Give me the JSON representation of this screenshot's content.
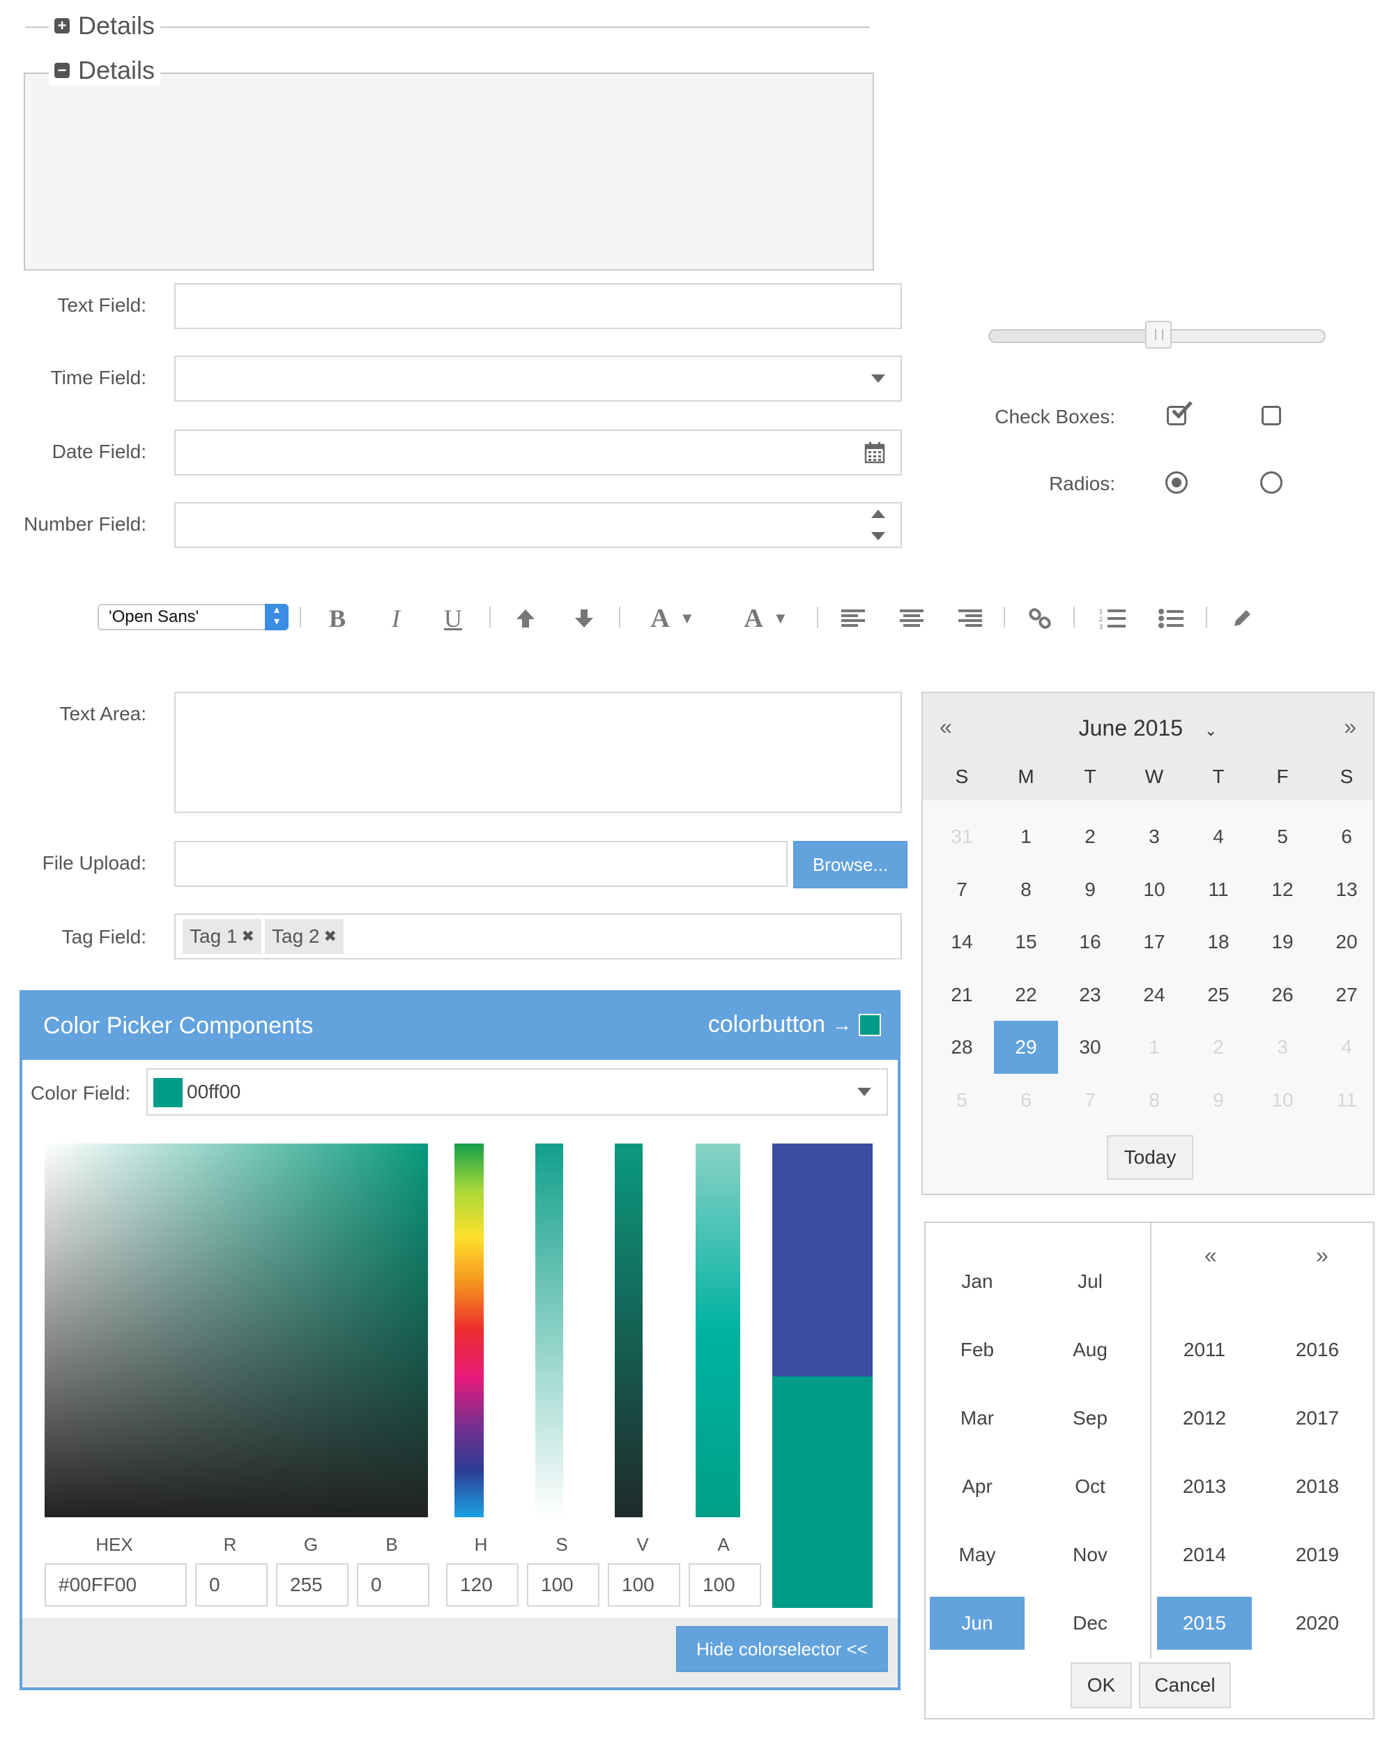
{
  "fieldsets": {
    "collapsed": {
      "legend": "Details",
      "icon": "plus-square-icon"
    },
    "expanded": {
      "legend": "Details",
      "icon": "minus-square-icon"
    }
  },
  "form": {
    "text_field": {
      "label": "Text Field:",
      "value": ""
    },
    "time_field": {
      "label": "Time Field:",
      "value": "",
      "icon": "caret-down-icon"
    },
    "date_field": {
      "label": "Date Field:",
      "value": "",
      "icon": "calendar-icon"
    },
    "number_field": {
      "label": "Number Field:",
      "value": "",
      "icon": "spinner-arrows-icon"
    },
    "text_area": {
      "label": "Text Area:",
      "value": ""
    },
    "file_upload": {
      "label": "File Upload:",
      "value": "",
      "button": "Browse..."
    },
    "tag_field": {
      "label": "Tag Field:",
      "tags": [
        "Tag 1",
        "Tag 2"
      ]
    }
  },
  "slider": {
    "value": 0.5
  },
  "checkboxes": {
    "label": "Check Boxes:",
    "states": [
      true,
      false
    ]
  },
  "radios": {
    "label": "Radios:",
    "states": [
      true,
      false
    ]
  },
  "toolbar": {
    "font": "'Open Sans'",
    "buttons": [
      "bold",
      "italic",
      "underline",
      "superscript",
      "subscript",
      "font-color",
      "highlight-color",
      "align-left",
      "align-center",
      "align-right",
      "link",
      "ordered-list",
      "unordered-list",
      "source"
    ]
  },
  "color_picker": {
    "title": "Color Picker Components",
    "colorbutton_label": "colorbutton",
    "colorbutton_color": "#009c87",
    "color_field_label": "Color Field:",
    "color_field_value": "00ff00",
    "color_field_swatch": "#009c87",
    "channels": {
      "HEX": "#00FF00",
      "R": "0",
      "G": "255",
      "B": "0",
      "H": "120",
      "S": "100",
      "V": "100",
      "A": "100"
    },
    "preview_old": "#3a4d9e",
    "preview_new": "#009c87",
    "hide_button": "Hide colorselector <<"
  },
  "calendar": {
    "title": "June 2015",
    "weekdays": [
      "S",
      "M",
      "T",
      "W",
      "T",
      "F",
      "S"
    ],
    "weeks": [
      [
        "31",
        "1",
        "2",
        "3",
        "4",
        "5",
        "6"
      ],
      [
        "7",
        "8",
        "9",
        "10",
        "11",
        "12",
        "13"
      ],
      [
        "14",
        "15",
        "16",
        "17",
        "18",
        "19",
        "20"
      ],
      [
        "21",
        "22",
        "23",
        "24",
        "25",
        "26",
        "27"
      ],
      [
        "28",
        "29",
        "30",
        "1",
        "2",
        "3",
        "4"
      ],
      [
        "5",
        "6",
        "7",
        "8",
        "9",
        "10",
        "11"
      ]
    ],
    "selected": "29",
    "today_button": "Today"
  },
  "month_year_picker": {
    "months_left": [
      "Jan",
      "Feb",
      "Mar",
      "Apr",
      "May",
      "Jun"
    ],
    "months_right": [
      "Jul",
      "Aug",
      "Sep",
      "Oct",
      "Nov",
      "Dec"
    ],
    "years_left": [
      "2011",
      "2012",
      "2013",
      "2014",
      "2015"
    ],
    "years_right": [
      "2016",
      "2017",
      "2018",
      "2019",
      "2020"
    ],
    "selected_month": "Jun",
    "selected_year": "2015",
    "ok_button": "OK",
    "cancel_button": "Cancel"
  }
}
